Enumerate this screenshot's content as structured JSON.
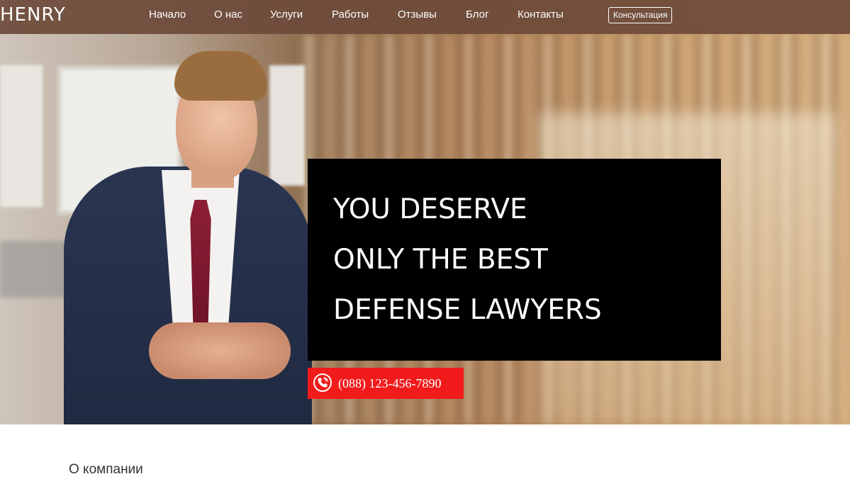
{
  "header": {
    "logo": "HENRY",
    "nav": [
      {
        "label": "Начало"
      },
      {
        "label": "О нас"
      },
      {
        "label": "Услуги"
      },
      {
        "label": "Работы"
      },
      {
        "label": "Отзывы"
      },
      {
        "label": "Блог"
      },
      {
        "label": "Контакты"
      }
    ],
    "cta_label": "Консультация"
  },
  "hero": {
    "headline": [
      "YOU DESERVE",
      "ONLY THE BEST",
      "DEFENSE LAWYERS"
    ],
    "phone": "(088) 123-456-7890",
    "phone_icon": "phone-icon"
  },
  "about": {
    "title": "О компании"
  },
  "colors": {
    "navbar": "#6c4a3a",
    "headline_bg": "#000000",
    "phone_bg": "#f21b1b",
    "text_light": "#ffffff"
  }
}
